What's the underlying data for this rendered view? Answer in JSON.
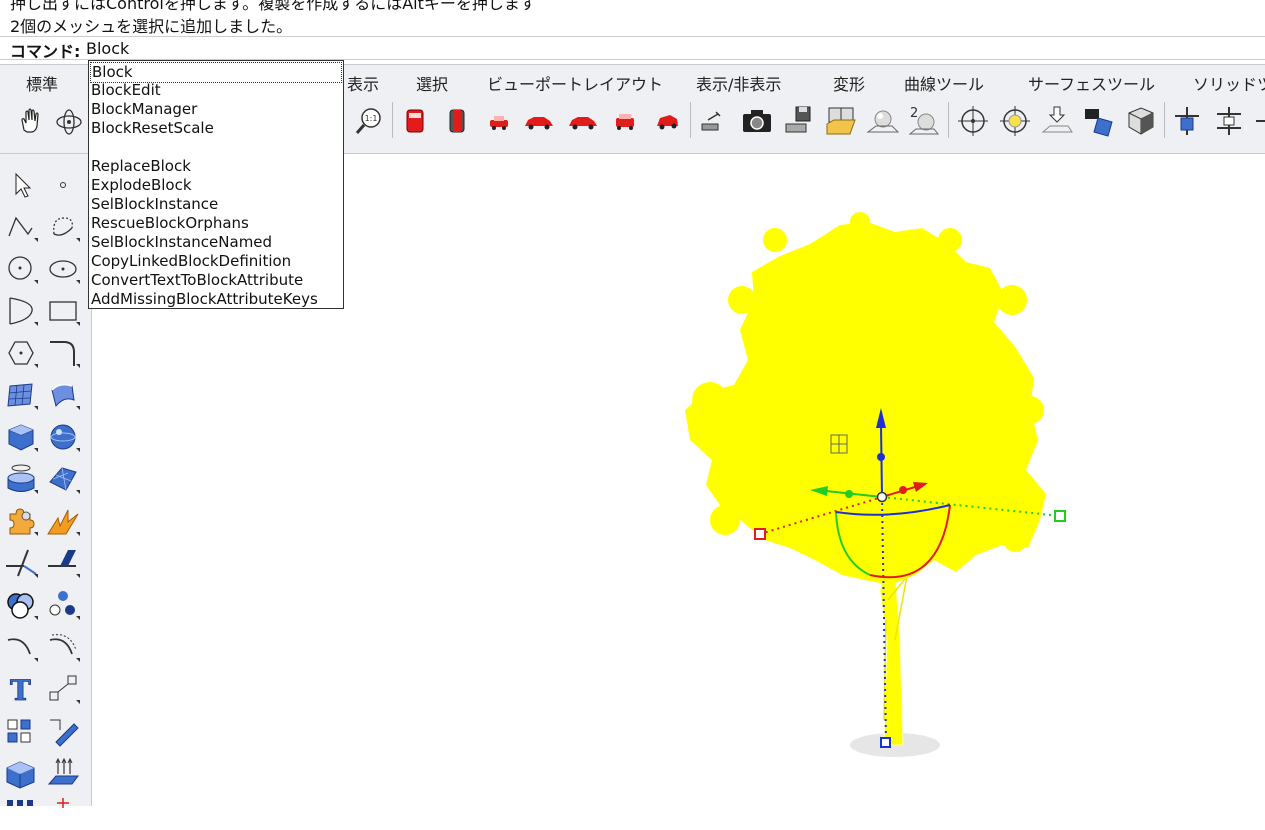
{
  "history": {
    "line1": "押し出すにはControlを押します。複製を作成するにはAltキーを押します",
    "line2": "2個のメッシュを選択に追加しました。"
  },
  "command": {
    "label": "コマンド:",
    "value": "Block"
  },
  "tabs": [
    "標準",
    "表示",
    "選択",
    "ビューポートレイアウト",
    "表示/非表示",
    "変形",
    "曲線ツール",
    "サーフェスツール",
    "ソリッドツ"
  ],
  "autocomplete": {
    "items": [
      "Block",
      "BlockEdit",
      "BlockManager",
      "BlockResetScale",
      "",
      "ReplaceBlock",
      "ExplodeBlock",
      "SelBlockInstance",
      "RescueBlockOrphans",
      "SelBlockInstanceNamed",
      "CopyLinkedBlockDefinition",
      "ConvertTextToBlockAttribute",
      "AddMissingBlockAttributeKeys"
    ],
    "selected_index": 0
  },
  "icons": {
    "toolbar": [
      "pan-hand-icon",
      "rotate-view-icon",
      "zoom-1to1-icon",
      "car-front-red-icon",
      "car-front-dark-icon",
      "car-small-red-icon",
      "car-red-side-icon",
      "car-red-side-2-icon",
      "car-red-rear-icon",
      "car-red-perspective-icon",
      "named-view-icon",
      "camera-icon",
      "save-view-icon",
      "viewport-layout-icon",
      "sphere-render-icon",
      "sphere-2-icon",
      "target-snap-icon",
      "target-yellow-icon",
      "arrow-down-plane-icon",
      "camera-photo-icon",
      "box-view-icon",
      "gumball-align-icon",
      "gumball-align-2-icon"
    ],
    "leftbar": [
      "select-arrow-icon",
      "point-icon",
      "polyline-icon",
      "curve-icon",
      "circle-icon",
      "ellipse-icon",
      "arc-icon",
      "rectangle-icon",
      "polygon-icon",
      "fillet-icon",
      "surface-patch-icon",
      "surface-edge-icon",
      "solid-box-icon",
      "solid-sphere-icon",
      "cylinder-icon",
      "mesh-surface-icon",
      "puzzle-icon",
      "explode-icon",
      "split-icon",
      "trim-icon",
      "boolean-icon",
      "circles-icon",
      "curve-offset-icon",
      "curve-blend-icon",
      "text-icon",
      "scale-icon",
      "array-icon",
      "transform-icon",
      "box-3d-icon",
      "arrows-up-icon",
      "grid-icon",
      "misc-icon"
    ]
  },
  "colors": {
    "foliage": "#ffff00",
    "axis_x": "#e21b1b",
    "axis_y": "#22cc22",
    "axis_z": "#1e2fd6"
  }
}
